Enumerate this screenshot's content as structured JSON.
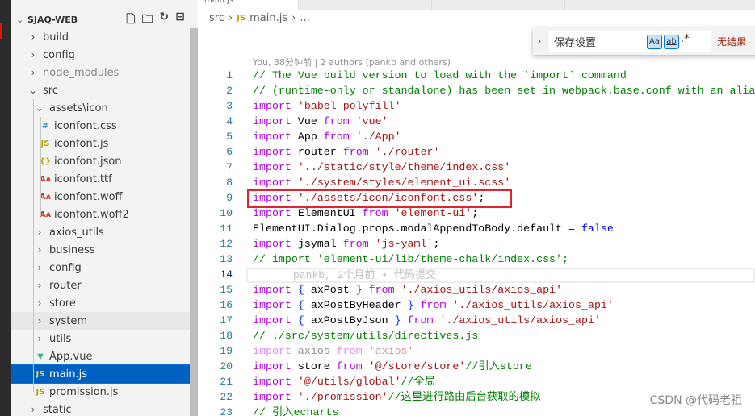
{
  "sidebar": {
    "project": "SJAQ-WEB",
    "actions": [
      "new-file-icon",
      "new-folder-icon",
      "refresh-icon",
      "collapse-all-icon"
    ],
    "items": [
      {
        "label": "build",
        "type": "folder",
        "depth": 0
      },
      {
        "label": "config",
        "type": "folder",
        "depth": 0
      },
      {
        "label": "node_modules",
        "type": "folder",
        "depth": 0,
        "faded": true
      },
      {
        "label": "src",
        "type": "folder-open",
        "depth": 0
      },
      {
        "label": "assets\\icon",
        "type": "folder-open",
        "depth": 1
      },
      {
        "label": "iconfont.css",
        "type": "css",
        "depth": 2
      },
      {
        "label": "iconfont.js",
        "type": "js",
        "depth": 2
      },
      {
        "label": "iconfont.json",
        "type": "json",
        "depth": 2
      },
      {
        "label": "iconfont.ttf",
        "type": "font",
        "depth": 2
      },
      {
        "label": "iconfont.woff",
        "type": "font",
        "depth": 2
      },
      {
        "label": "iconfont.woff2",
        "type": "font",
        "depth": 2
      },
      {
        "label": "axios_utils",
        "type": "folder",
        "depth": 1
      },
      {
        "label": "business",
        "type": "folder",
        "depth": 1
      },
      {
        "label": "config",
        "type": "folder",
        "depth": 1
      },
      {
        "label": "router",
        "type": "folder",
        "depth": 1
      },
      {
        "label": "store",
        "type": "folder",
        "depth": 1
      },
      {
        "label": "system",
        "type": "folder",
        "depth": 1,
        "hover": true
      },
      {
        "label": "utils",
        "type": "folder",
        "depth": 1
      },
      {
        "label": "App.vue",
        "type": "vue",
        "depth": 1
      },
      {
        "label": "main.js",
        "type": "js",
        "depth": 1,
        "selected": true
      },
      {
        "label": "promission.js",
        "type": "js",
        "depth": 1
      },
      {
        "label": "static",
        "type": "folder",
        "depth": 0
      }
    ]
  },
  "tabs": [
    {
      "label": "main.js",
      "active": true
    },
    {
      "label": ""
    },
    {
      "label": ""
    },
    {
      "label": ""
    }
  ],
  "breadcrumb": {
    "folder": "src",
    "file": "main.js",
    "more": "..."
  },
  "find": {
    "value": "保存设置",
    "match_case": "Aa",
    "whole_word": "ab",
    "regex": ".*",
    "result": "无结果"
  },
  "blame": {
    "header": "You, 38分钟前 | 2 authors (pankb and others)",
    "inline": "pankb, 2个月前 • 代码提交"
  },
  "current_line": 14,
  "highlighted_line": 9,
  "code": [
    [
      [
        "// The Vue build version to load with the `import` command",
        "c"
      ]
    ],
    [
      [
        "// (runtime-only or standalone) has been set in webpack.base.conf with an alias.",
        "c"
      ]
    ],
    [
      [
        "import",
        "k"
      ],
      [
        " "
      ],
      [
        "'babel-polyfill'",
        "s"
      ]
    ],
    [
      [
        "import",
        "k"
      ],
      [
        " Vue "
      ],
      [
        "from",
        "k"
      ],
      [
        " "
      ],
      [
        "'vue'",
        "s"
      ]
    ],
    [
      [
        "import",
        "k"
      ],
      [
        " App "
      ],
      [
        "from",
        "k"
      ],
      [
        " "
      ],
      [
        "'./App'",
        "s"
      ]
    ],
    [
      [
        "import",
        "k"
      ],
      [
        " router "
      ],
      [
        "from",
        "k"
      ],
      [
        " "
      ],
      [
        "'./router'",
        "s"
      ]
    ],
    [
      [
        "import",
        "k"
      ],
      [
        " "
      ],
      [
        "'../static/style/theme/index.css'",
        "s"
      ]
    ],
    [
      [
        "import",
        "k"
      ],
      [
        " "
      ],
      [
        "'./system/styles/element_ui.scss'",
        "s"
      ]
    ],
    [
      [
        "import",
        "k"
      ],
      [
        " "
      ],
      [
        "'./assets/icon/iconfont.css'",
        "s"
      ],
      [
        ";"
      ]
    ],
    [
      [
        "import",
        "k"
      ],
      [
        " ElementUI "
      ],
      [
        "from",
        "k"
      ],
      [
        " "
      ],
      [
        "'element-ui'",
        "s"
      ],
      [
        ";"
      ]
    ],
    [
      [
        "ElementUI.Dialog.props.modalAppendToBody.default = "
      ],
      [
        "false",
        "b"
      ]
    ],
    [
      [
        "import",
        "k"
      ],
      [
        " jsymal "
      ],
      [
        "from",
        "k"
      ],
      [
        " "
      ],
      [
        "'js-yaml'",
        "s"
      ],
      [
        ";"
      ]
    ],
    [
      [
        "// import 'element-ui/lib/theme-chalk/index.css';",
        "c"
      ]
    ],
    [],
    [
      [
        "import",
        "k"
      ],
      [
        " "
      ],
      [
        "{",
        "p"
      ],
      [
        " axPost "
      ],
      [
        "}",
        "p"
      ],
      [
        " "
      ],
      [
        "from",
        "k"
      ],
      [
        " "
      ],
      [
        "'./axios_utils/axios_api'",
        "s"
      ]
    ],
    [
      [
        "import",
        "k"
      ],
      [
        " "
      ],
      [
        "{",
        "p"
      ],
      [
        " axPostByHeader "
      ],
      [
        "}",
        "p"
      ],
      [
        " "
      ],
      [
        "from",
        "k"
      ],
      [
        " "
      ],
      [
        "'./axios_utils/axios_api'",
        "s"
      ]
    ],
    [
      [
        "import",
        "k"
      ],
      [
        " "
      ],
      [
        "{",
        "p"
      ],
      [
        " axPostByJson "
      ],
      [
        "}",
        "p"
      ],
      [
        " "
      ],
      [
        "from",
        "k"
      ],
      [
        " "
      ],
      [
        "'./axios_utils/axios_api'",
        "s"
      ]
    ],
    [
      [
        "// ./src/system/utils/directives.js",
        "c"
      ]
    ],
    [
      [
        "import",
        "k fd"
      ],
      [
        " axios ",
        "fd"
      ],
      [
        "from",
        "k fd"
      ],
      [
        " "
      ],
      [
        "'axios'",
        "s fd"
      ]
    ],
    [
      [
        "import",
        "k"
      ],
      [
        " store "
      ],
      [
        "from",
        "k"
      ],
      [
        " "
      ],
      [
        "'@/store/store'",
        "s"
      ],
      [
        "//引入store",
        "c"
      ]
    ],
    [
      [
        "import",
        "k"
      ],
      [
        " "
      ],
      [
        "'@/utils/global'",
        "s"
      ],
      [
        "//全局",
        "c"
      ]
    ],
    [
      [
        "import",
        "k"
      ],
      [
        " "
      ],
      [
        "'./promission'",
        "s"
      ],
      [
        "//这里进行路由后台获取的模拟",
        "c"
      ]
    ],
    [
      [
        "// 引入echarts",
        "c"
      ]
    ]
  ],
  "watermark": "CSDN @代码老祖"
}
